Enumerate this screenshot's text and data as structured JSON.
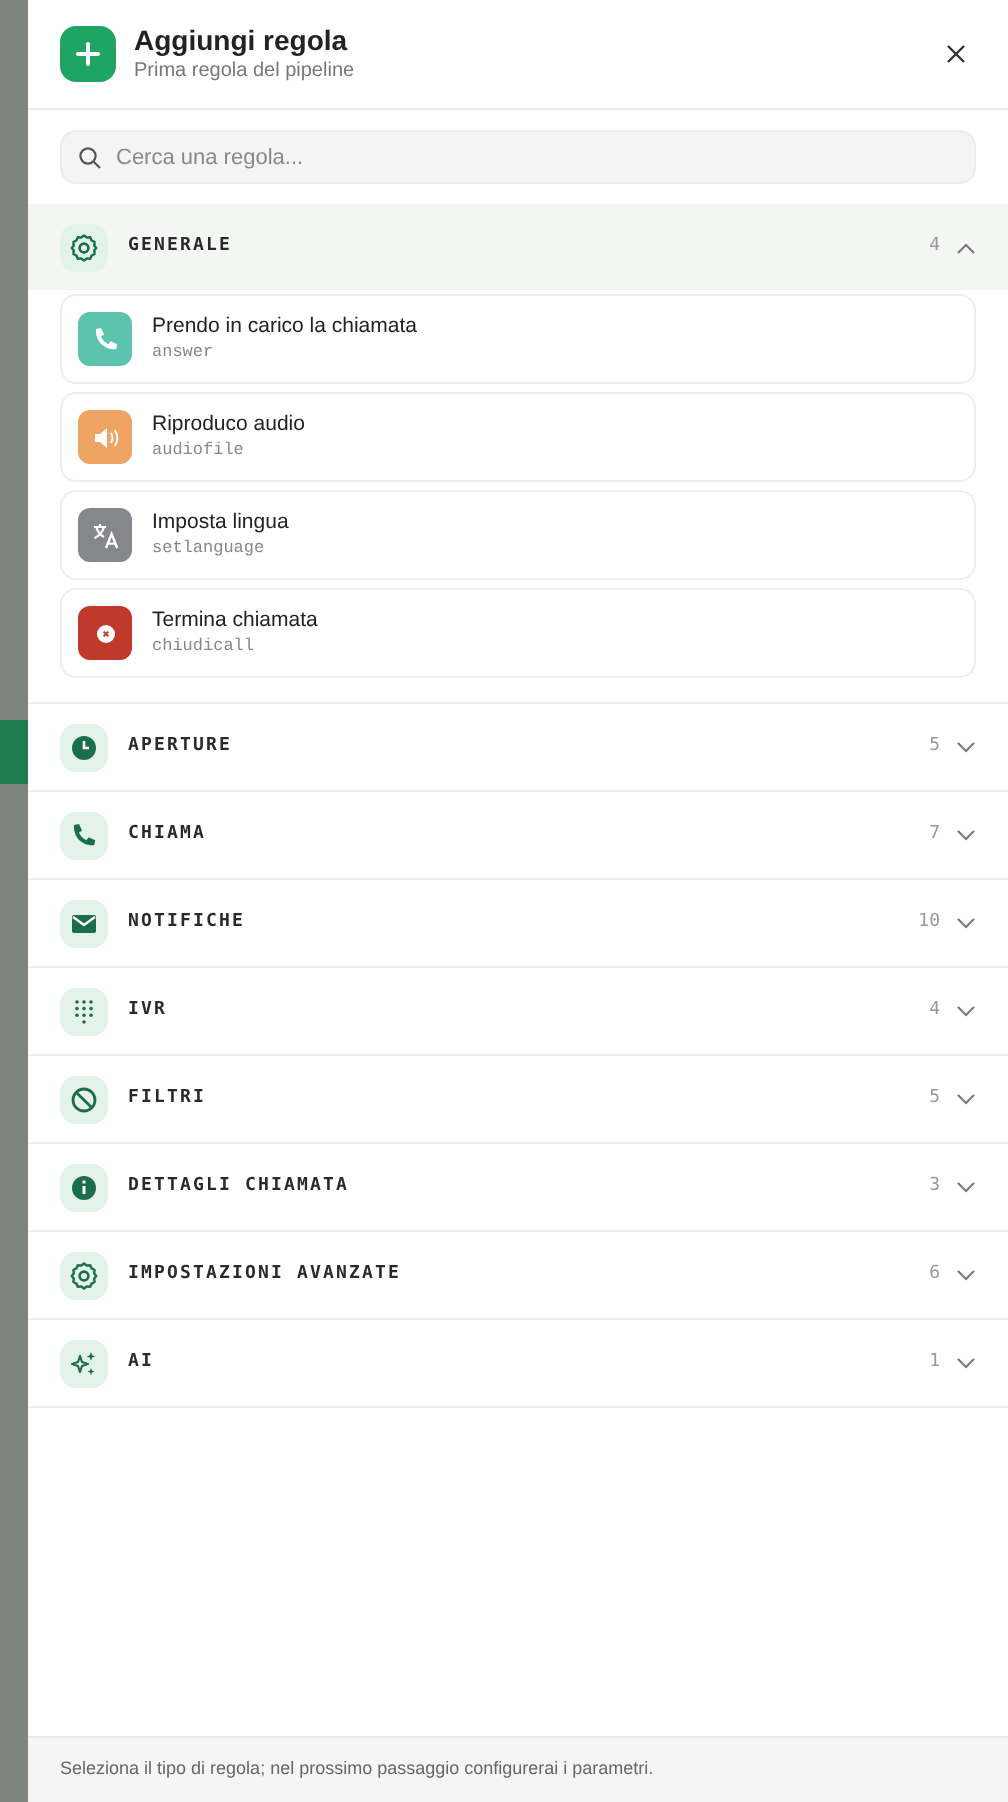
{
  "header": {
    "title": "Aggiungi regola",
    "subtitle": "Prima regola del pipeline"
  },
  "search": {
    "placeholder": "Cerca una regola..."
  },
  "groups": [
    {
      "label": "GENERALE",
      "count": "4",
      "kind": "gear",
      "expanded": true,
      "items": [
        {
          "title": "Prendo in carico la chiamata",
          "code": "answer",
          "kind": "phone",
          "color": "#5cc4ad"
        },
        {
          "title": "Riproduco audio",
          "code": "audiofile",
          "kind": "speaker",
          "color": "#f0a463"
        },
        {
          "title": "Imposta lingua",
          "code": "setlanguage",
          "kind": "translate",
          "color": "#86868e"
        },
        {
          "title": "Termina chiamata",
          "code": "chiudicall",
          "kind": "stop",
          "color": "#c0392b"
        }
      ]
    },
    {
      "label": "APERTURE",
      "count": "5",
      "kind": "clock",
      "expanded": false
    },
    {
      "label": "CHIAMA",
      "count": "7",
      "kind": "phone",
      "expanded": false
    },
    {
      "label": "NOTIFICHE",
      "count": "10",
      "kind": "mail",
      "expanded": false
    },
    {
      "label": "IVR",
      "count": "4",
      "kind": "dialpad",
      "expanded": false
    },
    {
      "label": "FILTRI",
      "count": "5",
      "kind": "ban",
      "expanded": false
    },
    {
      "label": "DETTAGLI CHIAMATA",
      "count": "3",
      "kind": "info",
      "expanded": false
    },
    {
      "label": "IMPOSTAZIONI AVANZATE",
      "count": "6",
      "kind": "gear",
      "expanded": false
    },
    {
      "label": "AI",
      "count": "1",
      "kind": "sparkles",
      "expanded": false
    }
  ],
  "footer": "Seleziona il tipo di regola; nel prossimo passaggio configurerai i parametri."
}
